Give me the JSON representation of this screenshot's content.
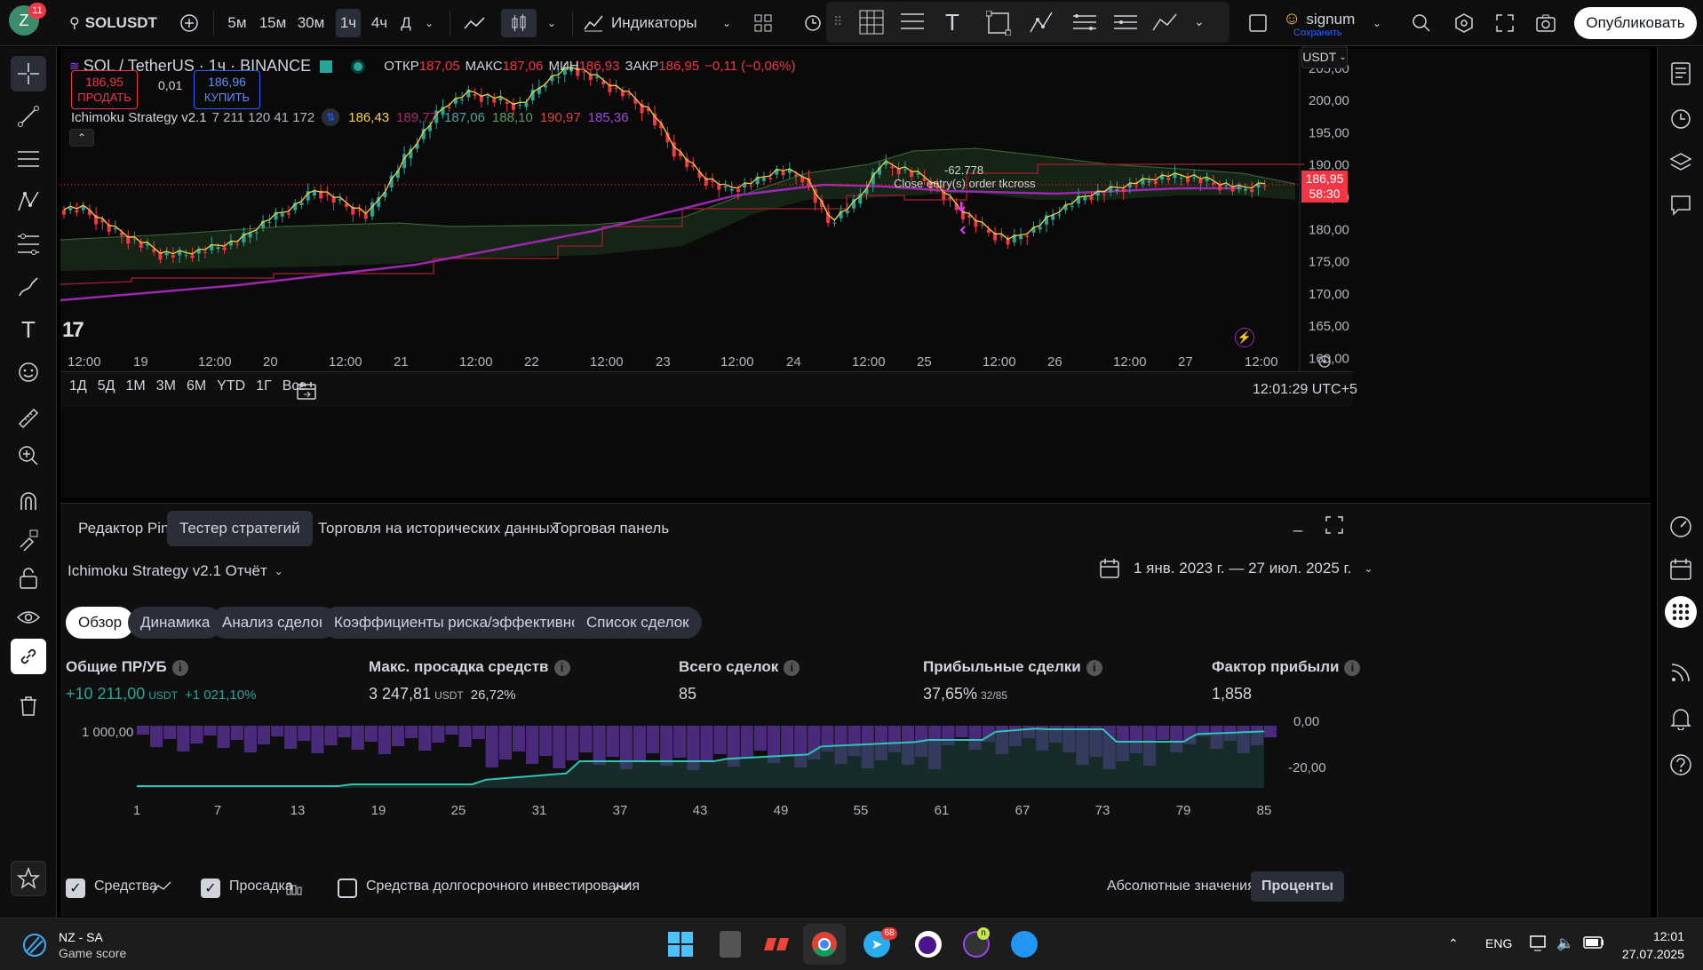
{
  "topbar": {
    "avatar_letter": "Z",
    "notif_count": "11",
    "symbol": "SOLUSDT",
    "intervals": [
      "5м",
      "15м",
      "30м",
      "1ч",
      "4ч",
      "Д"
    ],
    "active_interval": "1ч",
    "indicators_label": "Индикаторы",
    "user_name": "signum",
    "save_label": "Сохранить",
    "publish_label": "Опубликовать"
  },
  "legend": {
    "title": "SOL / TetherUS · 1ч · BINANCE",
    "open_label": "ОТКР",
    "open": "187,05",
    "high_label": "МАКС",
    "high": "187,06",
    "low_label": "МИН",
    "low": "186,93",
    "close_label": "ЗАКР",
    "close": "186,95",
    "change": "−0,11 (−0,06%)",
    "sell_price": "186,95",
    "sell_label": "ПРОДАТЬ",
    "spread": "0,01",
    "buy_price": "186,96",
    "buy_label": "КУПИТЬ",
    "strategy_name": "Ichimoku Strategy v2.1",
    "strategy_params": "7 211 120 41 172",
    "ind_values": [
      {
        "v": "186,43",
        "c": "#f5d442"
      },
      {
        "v": "189,77",
        "c": "#a0306a"
      },
      {
        "v": "187,06",
        "c": "#4fa3a5"
      },
      {
        "v": "188,10",
        "c": "#5b9b5b"
      },
      {
        "v": "190,97",
        "c": "#d9453f"
      },
      {
        "v": "185,36",
        "c": "#9a4dd6"
      }
    ]
  },
  "price_axis": {
    "currency": "USDT",
    "ticks": [
      "205,00",
      "200,00",
      "195,00",
      "190,00",
      "185,00",
      "180,00",
      "175,00",
      "170,00",
      "165,00",
      "160,00"
    ],
    "last_price": "186,95",
    "countdown": "58:30"
  },
  "time_axis": [
    "12:00",
    "19",
    "12:00",
    "20",
    "12:00",
    "21",
    "12:00",
    "22",
    "12:00",
    "23",
    "12:00",
    "24",
    "12:00",
    "25",
    "12:00",
    "26",
    "12:00",
    "27",
    "12:00"
  ],
  "chart_annotations": {
    "trade_value": "-62.778",
    "trade_label": "Close entry(s) order tkcross"
  },
  "ranges": [
    "1Д",
    "5Д",
    "1М",
    "3М",
    "6М",
    "YTD",
    "1Г",
    "Все"
  ],
  "clock": "12:01:29 UTC+5",
  "panel": {
    "tabs": [
      "Редактор Pine",
      "Тестер стратегий",
      "Торговля на исторических данных",
      "Торговая панель"
    ],
    "active_tab": "Тестер стратегий",
    "report_title": "Ichimoku Strategy v2.1 Отчёт",
    "date_range": "1 янв. 2023 г. — 27 июл. 2025 г.",
    "subtabs": [
      "Обзор",
      "Динамика",
      "Анализ сделок",
      "Коэффициенты риска/эффективности",
      "Список сделок"
    ],
    "active_subtab": "Обзор",
    "stats": [
      {
        "label": "Общие ПР/УБ",
        "value": "+10 211,00",
        "unit": "USDT",
        "extra": "+1 021,10%",
        "color": "#26a69a"
      },
      {
        "label": "Макс. просадка средств",
        "value": "3 247,81",
        "unit": "USDT",
        "extra": "26,72%",
        "color": "#d1d4dc"
      },
      {
        "label": "Всего сделок",
        "value": "85",
        "unit": "",
        "extra": "",
        "color": "#d1d4dc"
      },
      {
        "label": "Прибыльные сделки",
        "value": "37,65%",
        "unit": "32/85",
        "extra": "",
        "color": "#d1d4dc"
      },
      {
        "label": "Фактор прибыли",
        "value": "1,858",
        "unit": "",
        "extra": "",
        "color": "#d1d4dc"
      }
    ],
    "mini_chart": {
      "left_label": "1 000,00",
      "right_labels": [
        "0,00",
        "-20,00"
      ],
      "x_ticks": [
        "1",
        "7",
        "13",
        "19",
        "25",
        "31",
        "37",
        "43",
        "49",
        "55",
        "61",
        "67",
        "73",
        "79",
        "85"
      ]
    },
    "checkboxes": [
      {
        "label": "Средства",
        "checked": true
      },
      {
        "label": "Просадка",
        "checked": true
      },
      {
        "label": "Средства долгосрочного инвестирования",
        "checked": false
      }
    ],
    "mode_abs": "Абсолютные значения",
    "mode_pct": "Проценты"
  },
  "taskbar": {
    "weather_title": "NZ - SA",
    "weather_sub": "Game score",
    "lang": "ENG",
    "time": "12:01",
    "date": "27.07.2025",
    "telegram_badge": "68"
  },
  "chart_data": {
    "type": "line",
    "title": "SOL / TetherUS · 1ч · BINANCE",
    "ylim": [
      158,
      208
    ],
    "series": [
      {
        "name": "close",
        "values": [
          183,
          180,
          178,
          176,
          176,
          177,
          178,
          181,
          183,
          186,
          184,
          182,
          188,
          194,
          199,
          201,
          200,
          199,
          203,
          205,
          203,
          201,
          198,
          192,
          188,
          186,
          187,
          189,
          188,
          181,
          184,
          190,
          189,
          187,
          183,
          180,
          178,
          180,
          183,
          185,
          186,
          187,
          188,
          188,
          187,
          186,
          187
        ]
      }
    ]
  }
}
